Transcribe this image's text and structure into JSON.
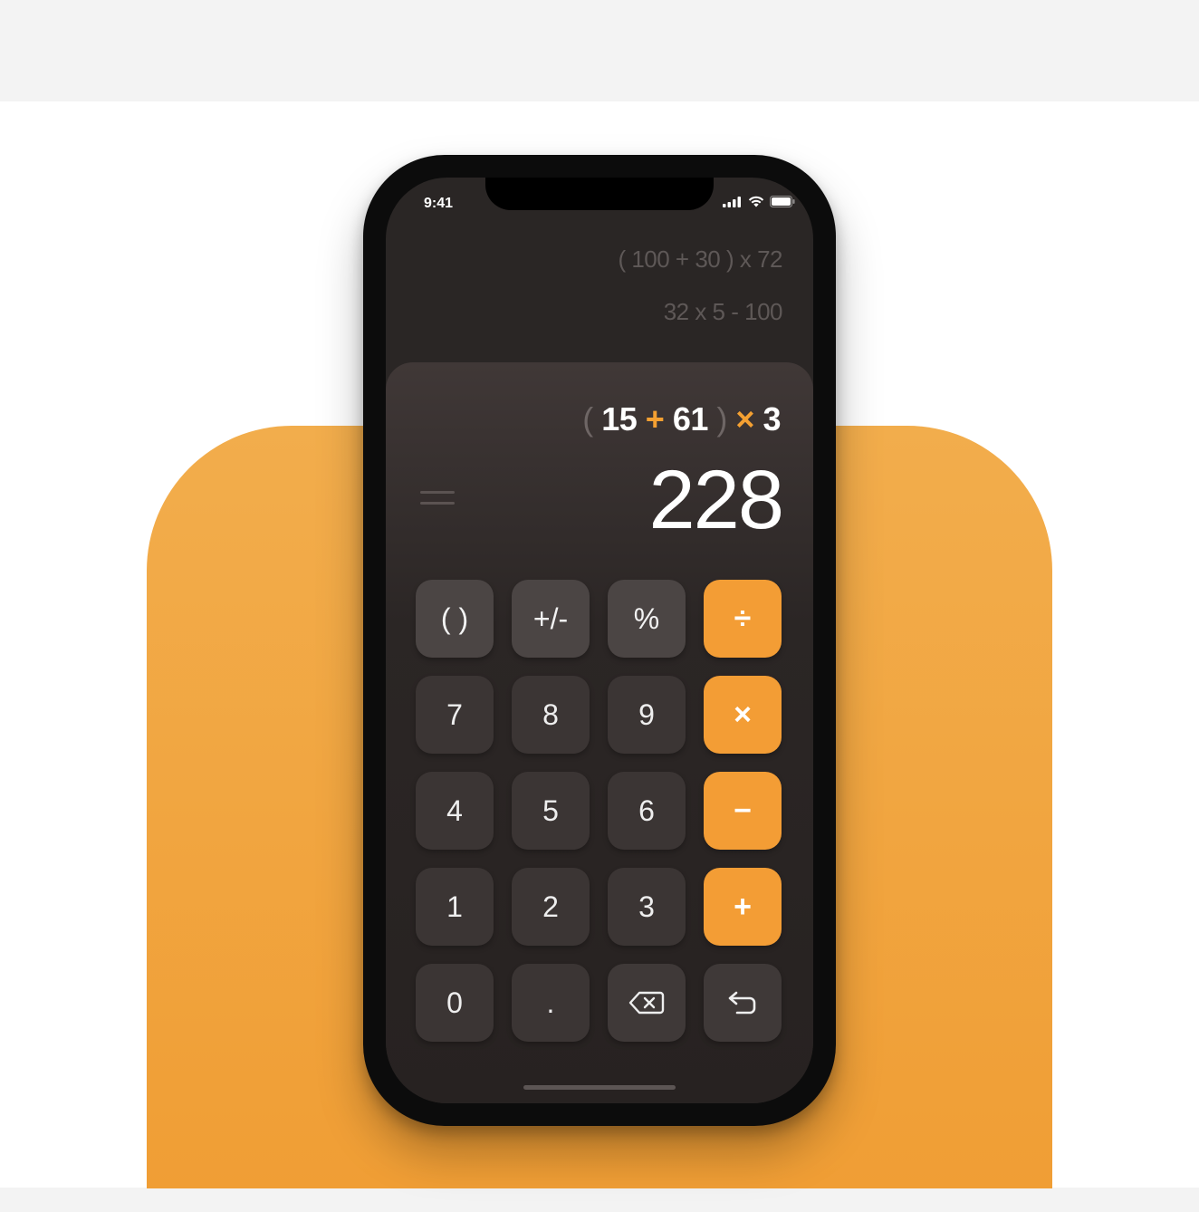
{
  "status": {
    "time": "9:41"
  },
  "history": [
    "( 100 + 30 ) x 72",
    "32 x 5 - 100"
  ],
  "expression": {
    "open_paren": "(",
    "num1": "15",
    "op1": "+",
    "num2": "61",
    "close_paren": ")",
    "op2": "×",
    "num3": "3"
  },
  "result": "228",
  "keys": {
    "parens": "( )",
    "plus_minus": "+/-",
    "percent": "%",
    "divide": "÷",
    "seven": "7",
    "eight": "8",
    "nine": "9",
    "multiply": "×",
    "four": "4",
    "five": "5",
    "six": "6",
    "minus": "−",
    "one": "1",
    "two": "2",
    "three": "3",
    "plus": "+",
    "zero": "0",
    "decimal": ".",
    "backspace_icon": "backspace-icon",
    "enter_icon": "return-icon"
  },
  "colors": {
    "accent": "#f39d35",
    "background_orange": "#f0a43f",
    "screen": "#2a2625",
    "key": "#3b3534"
  }
}
